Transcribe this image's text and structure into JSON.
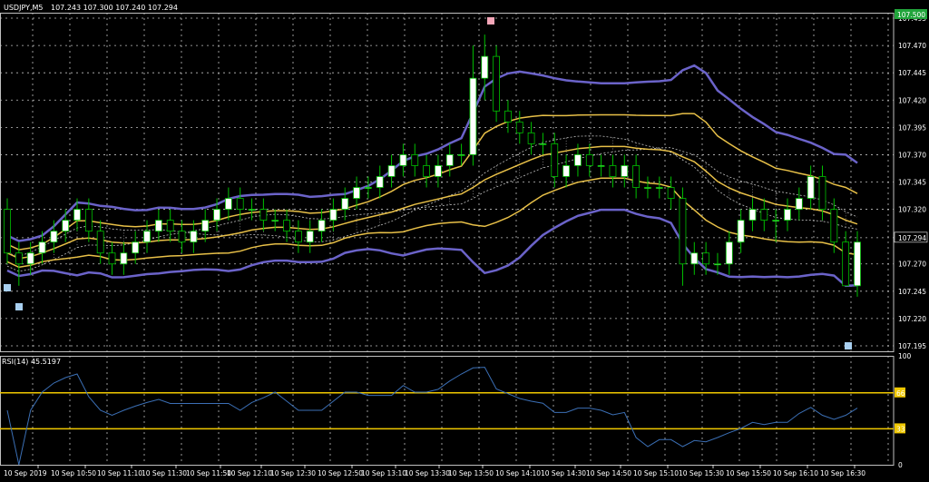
{
  "header": {
    "symbol": "USDJPY,M5",
    "quote": "107.243 107.300 107.240 107.294"
  },
  "rsi_panel": {
    "title": "RSI(14) 45.5197",
    "levels": [
      100,
      66,
      33,
      0
    ],
    "upper": 66,
    "lower": 33,
    "upper_label": "66",
    "lower_label": "33",
    "top_label": "100",
    "bottom_label": "0"
  },
  "colors": {
    "background": "#000000",
    "grid": "#c0c0c0",
    "bull_candle": "#ffffff",
    "bear_candle": "#000000",
    "wick": "#00c000",
    "bollinger_outer": "#6b63c9",
    "bollinger_inner": "#e8c048",
    "ichimoku_cloud": "#c0c0c0",
    "rsi_line": "#3b6fb5",
    "rsi_levels": "#f0c800",
    "price_tag": "#21a43b"
  },
  "chart_data": {
    "type": "candlestick",
    "ylim": [
      107.19,
      107.5
    ],
    "price_ticks": [
      "107.495",
      "107.470",
      "107.445",
      "107.420",
      "107.395",
      "107.370",
      "107.345",
      "107.320",
      "107.294",
      "107.270",
      "107.245",
      "107.220",
      "107.195"
    ],
    "current_price": "107.294",
    "top_price_tag": "107.500",
    "time_ticks": [
      "10 Sep 2019",
      "10 Sep 10:50",
      "10 Sep 11:10",
      "10 Sep 11:30",
      "10 Sep 11:50",
      "10 Sep 12:10",
      "10 Sep 12:30",
      "10 Sep 12:50",
      "10 Sep 13:10",
      "10 Sep 13:30",
      "10 Sep 13:50",
      "10 Sep 14:10",
      "10 Sep 14:30",
      "10 Sep 14:50",
      "10 Sep 15:10",
      "10 Sep 15:30",
      "10 Sep 15:50",
      "10 Sep 16:10",
      "10 Sep 16:30"
    ],
    "candles": [
      [
        107.32,
        107.33,
        107.27,
        107.28
      ],
      [
        107.28,
        107.29,
        107.25,
        107.27
      ],
      [
        107.27,
        107.29,
        107.26,
        107.28
      ],
      [
        107.28,
        107.3,
        107.27,
        107.29
      ],
      [
        107.29,
        107.31,
        107.28,
        107.3
      ],
      [
        107.3,
        107.32,
        107.29,
        107.31
      ],
      [
        107.31,
        107.33,
        107.3,
        107.32
      ],
      [
        107.32,
        107.33,
        107.29,
        107.3
      ],
      [
        107.3,
        107.31,
        107.27,
        107.28
      ],
      [
        107.28,
        107.29,
        107.26,
        107.27
      ],
      [
        107.27,
        107.29,
        107.26,
        107.28
      ],
      [
        107.28,
        107.3,
        107.27,
        107.29
      ],
      [
        107.29,
        107.31,
        107.28,
        107.3
      ],
      [
        107.3,
        107.32,
        107.29,
        107.31
      ],
      [
        107.31,
        107.32,
        107.29,
        107.3
      ],
      [
        107.3,
        107.31,
        107.28,
        107.29
      ],
      [
        107.29,
        107.31,
        107.28,
        107.3
      ],
      [
        107.3,
        107.32,
        107.29,
        107.31
      ],
      [
        107.31,
        107.33,
        107.3,
        107.32
      ],
      [
        107.32,
        107.34,
        107.31,
        107.33
      ],
      [
        107.33,
        107.34,
        107.31,
        107.32
      ],
      [
        107.32,
        107.33,
        107.31,
        107.32
      ],
      [
        107.32,
        107.33,
        107.3,
        107.31
      ],
      [
        107.31,
        107.32,
        107.3,
        107.31
      ],
      [
        107.31,
        107.32,
        107.29,
        107.3
      ],
      [
        107.3,
        107.31,
        107.28,
        107.29
      ],
      [
        107.29,
        107.31,
        107.28,
        107.3
      ],
      [
        107.3,
        107.32,
        107.29,
        107.31
      ],
      [
        107.31,
        107.33,
        107.3,
        107.32
      ],
      [
        107.32,
        107.34,
        107.31,
        107.33
      ],
      [
        107.33,
        107.35,
        107.32,
        107.34
      ],
      [
        107.34,
        107.35,
        107.33,
        107.34
      ],
      [
        107.34,
        107.36,
        107.33,
        107.35
      ],
      [
        107.35,
        107.37,
        107.34,
        107.36
      ],
      [
        107.36,
        107.38,
        107.35,
        107.37
      ],
      [
        107.37,
        107.38,
        107.35,
        107.36
      ],
      [
        107.36,
        107.37,
        107.34,
        107.35
      ],
      [
        107.35,
        107.37,
        107.34,
        107.36
      ],
      [
        107.36,
        107.38,
        107.35,
        107.37
      ],
      [
        107.37,
        107.38,
        107.36,
        107.37
      ],
      [
        107.37,
        107.47,
        107.36,
        107.44
      ],
      [
        107.44,
        107.48,
        107.42,
        107.46
      ],
      [
        107.46,
        107.47,
        107.4,
        107.41
      ],
      [
        107.41,
        107.42,
        107.39,
        107.4
      ],
      [
        107.4,
        107.41,
        107.38,
        107.39
      ],
      [
        107.39,
        107.4,
        107.37,
        107.38
      ],
      [
        107.38,
        107.39,
        107.37,
        107.38
      ],
      [
        107.38,
        107.39,
        107.34,
        107.35
      ],
      [
        107.35,
        107.37,
        107.34,
        107.36
      ],
      [
        107.36,
        107.38,
        107.35,
        107.37
      ],
      [
        107.37,
        107.38,
        107.35,
        107.36
      ],
      [
        107.36,
        107.37,
        107.35,
        107.36
      ],
      [
        107.36,
        107.37,
        107.34,
        107.35
      ],
      [
        107.35,
        107.37,
        107.34,
        107.36
      ],
      [
        107.36,
        107.37,
        107.33,
        107.34
      ],
      [
        107.34,
        107.35,
        107.33,
        107.34
      ],
      [
        107.34,
        107.35,
        107.33,
        107.34
      ],
      [
        107.34,
        107.35,
        107.32,
        107.33
      ],
      [
        107.33,
        107.34,
        107.25,
        107.27
      ],
      [
        107.27,
        107.29,
        107.26,
        107.28
      ],
      [
        107.28,
        107.29,
        107.26,
        107.27
      ],
      [
        107.27,
        107.28,
        107.26,
        107.27
      ],
      [
        107.27,
        107.3,
        107.26,
        107.29
      ],
      [
        107.29,
        107.32,
        107.28,
        107.31
      ],
      [
        107.31,
        107.33,
        107.3,
        107.32
      ],
      [
        107.32,
        107.33,
        107.3,
        107.31
      ],
      [
        107.31,
        107.32,
        107.29,
        107.31
      ],
      [
        107.31,
        107.33,
        107.3,
        107.32
      ],
      [
        107.32,
        107.34,
        107.31,
        107.33
      ],
      [
        107.33,
        107.36,
        107.32,
        107.35
      ],
      [
        107.35,
        107.36,
        107.31,
        107.32
      ],
      [
        107.32,
        107.33,
        107.28,
        107.29
      ],
      [
        107.29,
        107.3,
        107.25,
        107.25
      ],
      [
        107.25,
        107.3,
        107.24,
        107.29
      ]
    ]
  }
}
